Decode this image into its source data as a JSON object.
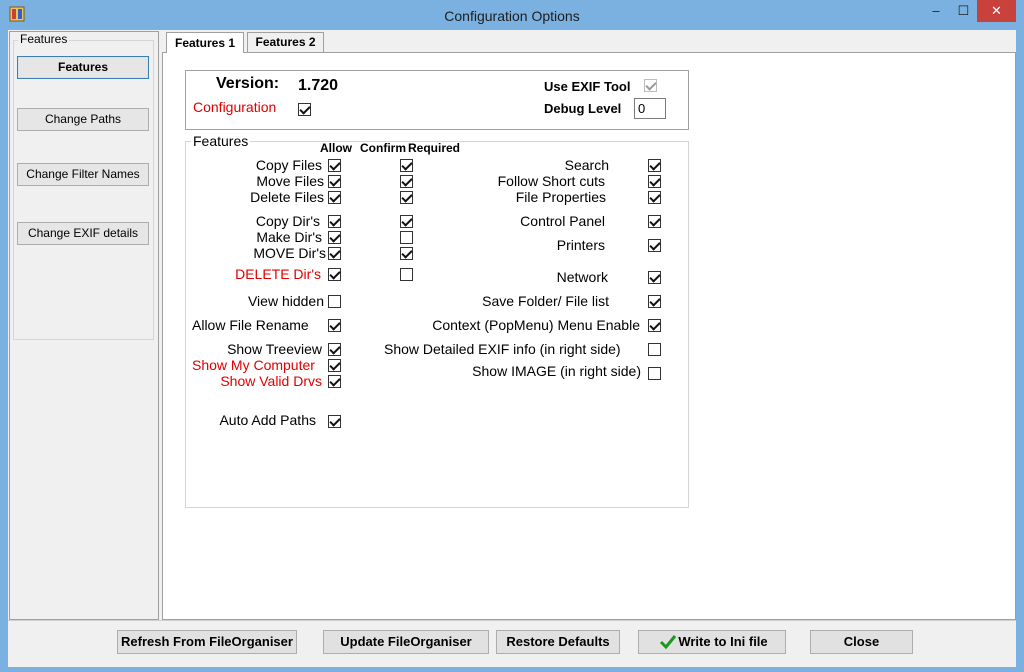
{
  "window": {
    "title": "Configuration Options",
    "min": "–",
    "max": "☐",
    "close": "✕"
  },
  "left": {
    "group_label": "Features",
    "buttons": [
      "Features",
      "Change Paths",
      "Change Filter Names",
      "Change EXIF details"
    ]
  },
  "tabs": [
    "Features 1",
    "Features 2"
  ],
  "header": {
    "version_label": "Version:",
    "version_value": "1.720",
    "configuration_label": "Configuration",
    "use_exif_label": "Use EXIF Tool",
    "debug_label": "Debug Level",
    "debug_value": "0"
  },
  "features": {
    "group_label": "Features",
    "col_allow": "Allow",
    "col_confirm": "Confirm",
    "col_required": "Required",
    "left_items": [
      {
        "label": "Copy Files",
        "allow": true,
        "confirm": true
      },
      {
        "label": "Move Files",
        "allow": true,
        "confirm": true
      },
      {
        "label": "Delete Files",
        "allow": true,
        "confirm": true
      },
      {
        "label": "Copy Dir's",
        "allow": true,
        "confirm": true
      },
      {
        "label": "Make Dir's",
        "allow": true,
        "confirm": false
      },
      {
        "label": "MOVE Dir's",
        "allow": true,
        "confirm": true
      },
      {
        "label": "DELETE Dir's",
        "allow": true,
        "confirm": false
      },
      {
        "label": "View hidden",
        "allow": false
      },
      {
        "label": "Allow File Rename",
        "allow": true
      },
      {
        "label": "Show Treeview",
        "allow": true
      },
      {
        "label": "Show My Computer",
        "allow": true
      },
      {
        "label": "Show Valid Drvs",
        "allow": true
      },
      {
        "label": "Auto Add Paths",
        "allow": true
      }
    ],
    "right_items": [
      {
        "label": "Search",
        "checked": true
      },
      {
        "label": "Follow Short cuts",
        "checked": true
      },
      {
        "label": "File Properties",
        "checked": true
      },
      {
        "label": "Control Panel",
        "checked": true
      },
      {
        "label": "Printers",
        "checked": true
      },
      {
        "label": "Network",
        "checked": true
      },
      {
        "label": "Save Folder/ File list",
        "checked": true
      },
      {
        "label": "Context (PopMenu) Menu Enable",
        "checked": true
      },
      {
        "label": "Show Detailed EXIF info (in right side)",
        "checked": false
      },
      {
        "label": "Show IMAGE (in right side)",
        "checked": false
      }
    ]
  },
  "footer": {
    "refresh": "Refresh From FileOrganiser",
    "update": "Update FileOrganiser",
    "restore": "Restore Defaults",
    "write": "Write to Ini file",
    "close": "Close"
  },
  "colors": {
    "title_bar": "#7ab1e0",
    "red_label": "#e00000",
    "close_button": "#c8413a"
  }
}
